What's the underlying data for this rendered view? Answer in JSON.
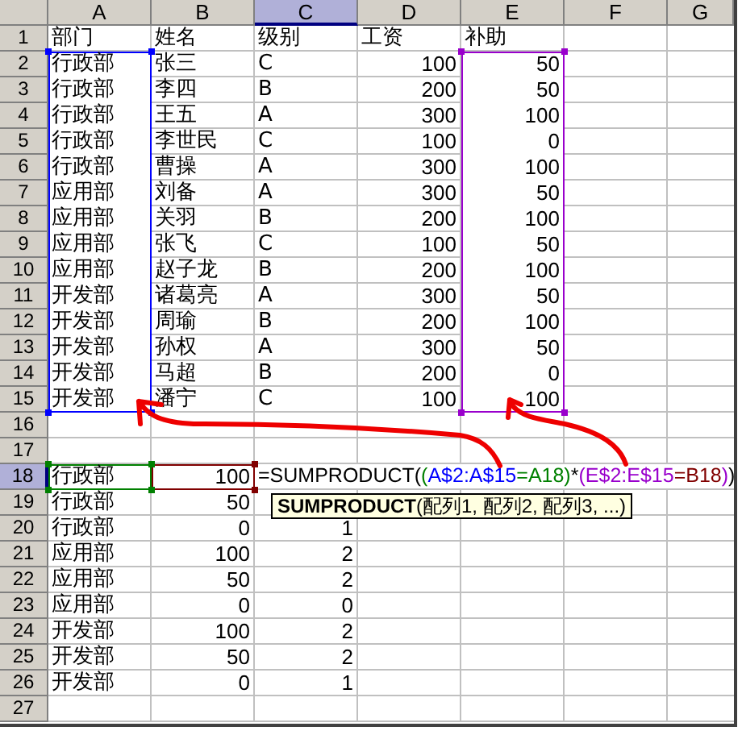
{
  "columns": [
    {
      "label": "A",
      "selected": false
    },
    {
      "label": "B",
      "selected": false
    },
    {
      "label": "C",
      "selected": true
    },
    {
      "label": "D",
      "selected": false
    },
    {
      "label": "E",
      "selected": false
    },
    {
      "label": "F",
      "selected": false
    },
    {
      "label": "G",
      "selected": false
    }
  ],
  "rows": [
    {
      "label": "1",
      "selected": false,
      "cells": [
        {
          "text": "部门",
          "kind": "text"
        },
        {
          "text": "姓名",
          "kind": "text"
        },
        {
          "text": "级别",
          "kind": "text"
        },
        {
          "text": "工资",
          "kind": "text"
        },
        {
          "text": "补助",
          "kind": "text"
        },
        {},
        {}
      ]
    },
    {
      "label": "2",
      "selected": false,
      "cells": [
        {
          "text": "行政部",
          "kind": "text",
          "color": "#0000ff"
        },
        {
          "text": "张三",
          "kind": "text"
        },
        {
          "text": "C",
          "kind": "text"
        },
        {
          "text": "100",
          "kind": "number"
        },
        {
          "text": "50",
          "kind": "number",
          "color": "#9900cc"
        },
        {},
        {}
      ]
    },
    {
      "label": "3",
      "selected": false,
      "cells": [
        {
          "text": "行政部",
          "kind": "text",
          "color": "#0000ff"
        },
        {
          "text": "李四",
          "kind": "text"
        },
        {
          "text": "B",
          "kind": "text"
        },
        {
          "text": "200",
          "kind": "number"
        },
        {
          "text": "50",
          "kind": "number",
          "color": "#9900cc"
        },
        {},
        {}
      ]
    },
    {
      "label": "4",
      "selected": false,
      "cells": [
        {
          "text": "行政部",
          "kind": "text",
          "color": "#0000ff"
        },
        {
          "text": "王五",
          "kind": "text"
        },
        {
          "text": "A",
          "kind": "text"
        },
        {
          "text": "300",
          "kind": "number"
        },
        {
          "text": "100",
          "kind": "number",
          "color": "#9900cc"
        },
        {},
        {}
      ]
    },
    {
      "label": "5",
      "selected": false,
      "cells": [
        {
          "text": "行政部",
          "kind": "text",
          "color": "#0000ff"
        },
        {
          "text": "李世民",
          "kind": "text"
        },
        {
          "text": "C",
          "kind": "text"
        },
        {
          "text": "100",
          "kind": "number"
        },
        {
          "text": "0",
          "kind": "number",
          "color": "#9900cc"
        },
        {},
        {}
      ]
    },
    {
      "label": "6",
      "selected": false,
      "cells": [
        {
          "text": "行政部",
          "kind": "text",
          "color": "#0000ff"
        },
        {
          "text": "曹操",
          "kind": "text"
        },
        {
          "text": "A",
          "kind": "text"
        },
        {
          "text": "300",
          "kind": "number"
        },
        {
          "text": "100",
          "kind": "number",
          "color": "#9900cc"
        },
        {},
        {}
      ]
    },
    {
      "label": "7",
      "selected": false,
      "cells": [
        {
          "text": "应用部",
          "kind": "text",
          "color": "#0000ff"
        },
        {
          "text": "刘备",
          "kind": "text"
        },
        {
          "text": "A",
          "kind": "text"
        },
        {
          "text": "300",
          "kind": "number"
        },
        {
          "text": "50",
          "kind": "number",
          "color": "#9900cc"
        },
        {},
        {}
      ]
    },
    {
      "label": "8",
      "selected": false,
      "cells": [
        {
          "text": "应用部",
          "kind": "text",
          "color": "#0000ff"
        },
        {
          "text": "关羽",
          "kind": "text"
        },
        {
          "text": "B",
          "kind": "text"
        },
        {
          "text": "200",
          "kind": "number"
        },
        {
          "text": "100",
          "kind": "number",
          "color": "#9900cc"
        },
        {},
        {}
      ]
    },
    {
      "label": "9",
      "selected": false,
      "cells": [
        {
          "text": "应用部",
          "kind": "text",
          "color": "#0000ff"
        },
        {
          "text": "张飞",
          "kind": "text"
        },
        {
          "text": "C",
          "kind": "text"
        },
        {
          "text": "100",
          "kind": "number"
        },
        {
          "text": "50",
          "kind": "number",
          "color": "#9900cc"
        },
        {},
        {}
      ]
    },
    {
      "label": "10",
      "selected": false,
      "cells": [
        {
          "text": "应用部",
          "kind": "text",
          "color": "#0000ff"
        },
        {
          "text": "赵子龙",
          "kind": "text"
        },
        {
          "text": "B",
          "kind": "text"
        },
        {
          "text": "200",
          "kind": "number"
        },
        {
          "text": "100",
          "kind": "number",
          "color": "#9900cc"
        },
        {},
        {}
      ]
    },
    {
      "label": "11",
      "selected": false,
      "cells": [
        {
          "text": "开发部",
          "kind": "text",
          "color": "#0000ff"
        },
        {
          "text": "诸葛亮",
          "kind": "text"
        },
        {
          "text": "A",
          "kind": "text"
        },
        {
          "text": "300",
          "kind": "number"
        },
        {
          "text": "50",
          "kind": "number",
          "color": "#9900cc"
        },
        {},
        {}
      ]
    },
    {
      "label": "12",
      "selected": false,
      "cells": [
        {
          "text": "开发部",
          "kind": "text",
          "color": "#0000ff"
        },
        {
          "text": "周瑜",
          "kind": "text"
        },
        {
          "text": "B",
          "kind": "text"
        },
        {
          "text": "200",
          "kind": "number"
        },
        {
          "text": "100",
          "kind": "number",
          "color": "#9900cc"
        },
        {},
        {}
      ]
    },
    {
      "label": "13",
      "selected": false,
      "cells": [
        {
          "text": "开发部",
          "kind": "text",
          "color": "#0000ff"
        },
        {
          "text": "孙权",
          "kind": "text"
        },
        {
          "text": "A",
          "kind": "text"
        },
        {
          "text": "300",
          "kind": "number"
        },
        {
          "text": "50",
          "kind": "number",
          "color": "#9900cc"
        },
        {},
        {}
      ]
    },
    {
      "label": "14",
      "selected": false,
      "cells": [
        {
          "text": "开发部",
          "kind": "text",
          "color": "#0000ff"
        },
        {
          "text": "马超",
          "kind": "text"
        },
        {
          "text": "B",
          "kind": "text"
        },
        {
          "text": "200",
          "kind": "number"
        },
        {
          "text": "0",
          "kind": "number",
          "color": "#9900cc"
        },
        {},
        {}
      ]
    },
    {
      "label": "15",
      "selected": false,
      "cells": [
        {
          "text": "开发部",
          "kind": "text",
          "color": "#0000ff"
        },
        {
          "text": "潘宁",
          "kind": "text"
        },
        {
          "text": "C",
          "kind": "text"
        },
        {
          "text": "100",
          "kind": "number"
        },
        {
          "text": "100",
          "kind": "number",
          "color": "#9900cc"
        },
        {},
        {}
      ]
    },
    {
      "label": "16",
      "selected": false,
      "cells": [
        {},
        {},
        {},
        {},
        {},
        {},
        {}
      ]
    },
    {
      "label": "17",
      "selected": false,
      "cells": [
        {},
        {},
        {},
        {},
        {},
        {},
        {}
      ]
    },
    {
      "label": "18",
      "selected": true,
      "cells": [
        {
          "text": "行政部",
          "kind": "text",
          "color": "#008000"
        },
        {
          "text": "100",
          "kind": "number",
          "color": "#800000"
        },
        {
          "kind": "formula",
          "segments": [
            {
              "text": "=SUMPRODUCT(",
              "color": "#000000"
            },
            {
              "text": "(",
              "color": "#008000"
            },
            {
              "text": "A$2:A$15",
              "color": "#0000ff"
            },
            {
              "text": "=A18)",
              "color": "#008000"
            },
            {
              "text": "*",
              "color": "#000000"
            },
            {
              "text": "(",
              "color": "#9900cc"
            },
            {
              "text": "E$2:E$15",
              "color": "#9900cc"
            },
            {
              "text": "=B18",
              "color": "#800000"
            },
            {
              "text": ")",
              "color": "#9900cc"
            },
            {
              "text": ")",
              "color": "#000000"
            }
          ]
        },
        {},
        {},
        {},
        {}
      ]
    },
    {
      "label": "19",
      "selected": false,
      "cells": [
        {
          "text": "行政部",
          "kind": "text"
        },
        {
          "text": "50",
          "kind": "number"
        },
        {},
        {},
        {},
        {},
        {}
      ]
    },
    {
      "label": "20",
      "selected": false,
      "cells": [
        {
          "text": "行政部",
          "kind": "text"
        },
        {
          "text": "0",
          "kind": "number"
        },
        {
          "text": "1",
          "kind": "number"
        },
        {},
        {},
        {},
        {}
      ]
    },
    {
      "label": "21",
      "selected": false,
      "cells": [
        {
          "text": "应用部",
          "kind": "text"
        },
        {
          "text": "100",
          "kind": "number"
        },
        {
          "text": "2",
          "kind": "number"
        },
        {},
        {},
        {},
        {}
      ]
    },
    {
      "label": "22",
      "selected": false,
      "cells": [
        {
          "text": "应用部",
          "kind": "text"
        },
        {
          "text": "50",
          "kind": "number"
        },
        {
          "text": "2",
          "kind": "number"
        },
        {},
        {},
        {},
        {}
      ]
    },
    {
      "label": "23",
      "selected": false,
      "cells": [
        {
          "text": "应用部",
          "kind": "text"
        },
        {
          "text": "0",
          "kind": "number"
        },
        {
          "text": "0",
          "kind": "number"
        },
        {},
        {},
        {},
        {}
      ]
    },
    {
      "label": "24",
      "selected": false,
      "cells": [
        {
          "text": "开发部",
          "kind": "text"
        },
        {
          "text": "100",
          "kind": "number"
        },
        {
          "text": "2",
          "kind": "number"
        },
        {},
        {},
        {},
        {}
      ]
    },
    {
      "label": "25",
      "selected": false,
      "cells": [
        {
          "text": "开发部",
          "kind": "text"
        },
        {
          "text": "50",
          "kind": "number"
        },
        {
          "text": "2",
          "kind": "number"
        },
        {},
        {},
        {},
        {}
      ]
    },
    {
      "label": "26",
      "selected": false,
      "cells": [
        {
          "text": "开发部",
          "kind": "text"
        },
        {
          "text": "0",
          "kind": "number"
        },
        {
          "text": "1",
          "kind": "number"
        },
        {},
        {},
        {},
        {}
      ]
    },
    {
      "label": "27",
      "selected": false,
      "cells": [
        {},
        {},
        {},
        {},
        {},
        {},
        {}
      ]
    }
  ],
  "tooltip": {
    "text": "**SUMPRODUCT**(配列1, 配列2, 配列3, ...)"
  }
}
